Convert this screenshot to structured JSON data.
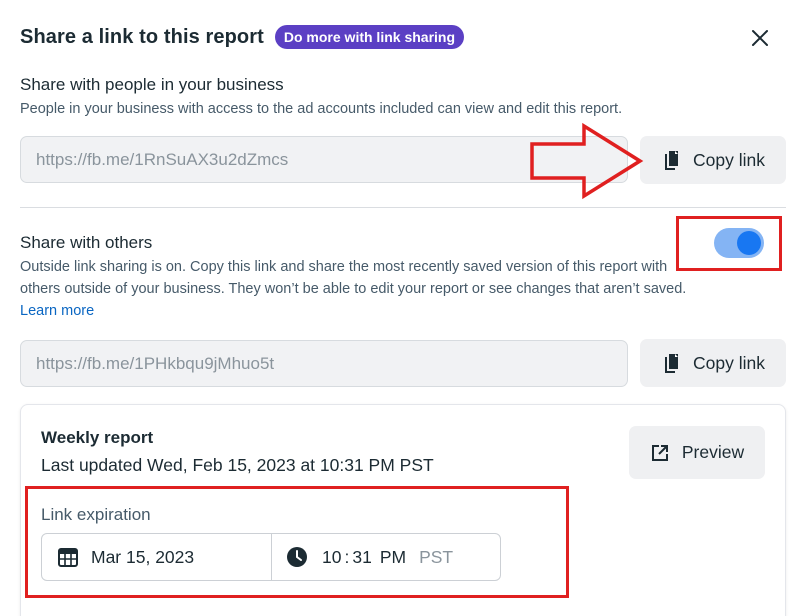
{
  "header": {
    "title": "Share a link to this report",
    "badge": "Do more with link sharing"
  },
  "business_share": {
    "title": "Share with people in your business",
    "description": "People in your business with access to the ad accounts included can view and edit this report.",
    "link": "https://fb.me/1RnSuAX3u2dZmcs",
    "copy_label": "Copy link"
  },
  "others_share": {
    "title": "Share with others",
    "description": "Outside link sharing is on. Copy this link and share the most recently saved version of this report with others outside of your business. They won’t be able to edit your report or see changes that aren’t saved.",
    "learn_more": "Learn more",
    "toggle_on": true,
    "link": "https://fb.me/1PHkbqu9jMhuo5t",
    "copy_label": "Copy link"
  },
  "report": {
    "name": "Weekly report",
    "last_updated": "Last updated Wed, Feb 15, 2023 at 10:31 PM PST",
    "preview_label": "Preview"
  },
  "expiration": {
    "label": "Link expiration",
    "date": "Mar 15, 2023",
    "hour": "10",
    "minute": "31",
    "ampm": "PM",
    "timezone": "PST"
  },
  "colors": {
    "accent": "#1877f2",
    "badge": "#5b3fc4",
    "annotation": "#e02020"
  },
  "icons": [
    "close-icon",
    "copy-icon",
    "external-link-icon",
    "calendar-icon",
    "clock-icon"
  ]
}
